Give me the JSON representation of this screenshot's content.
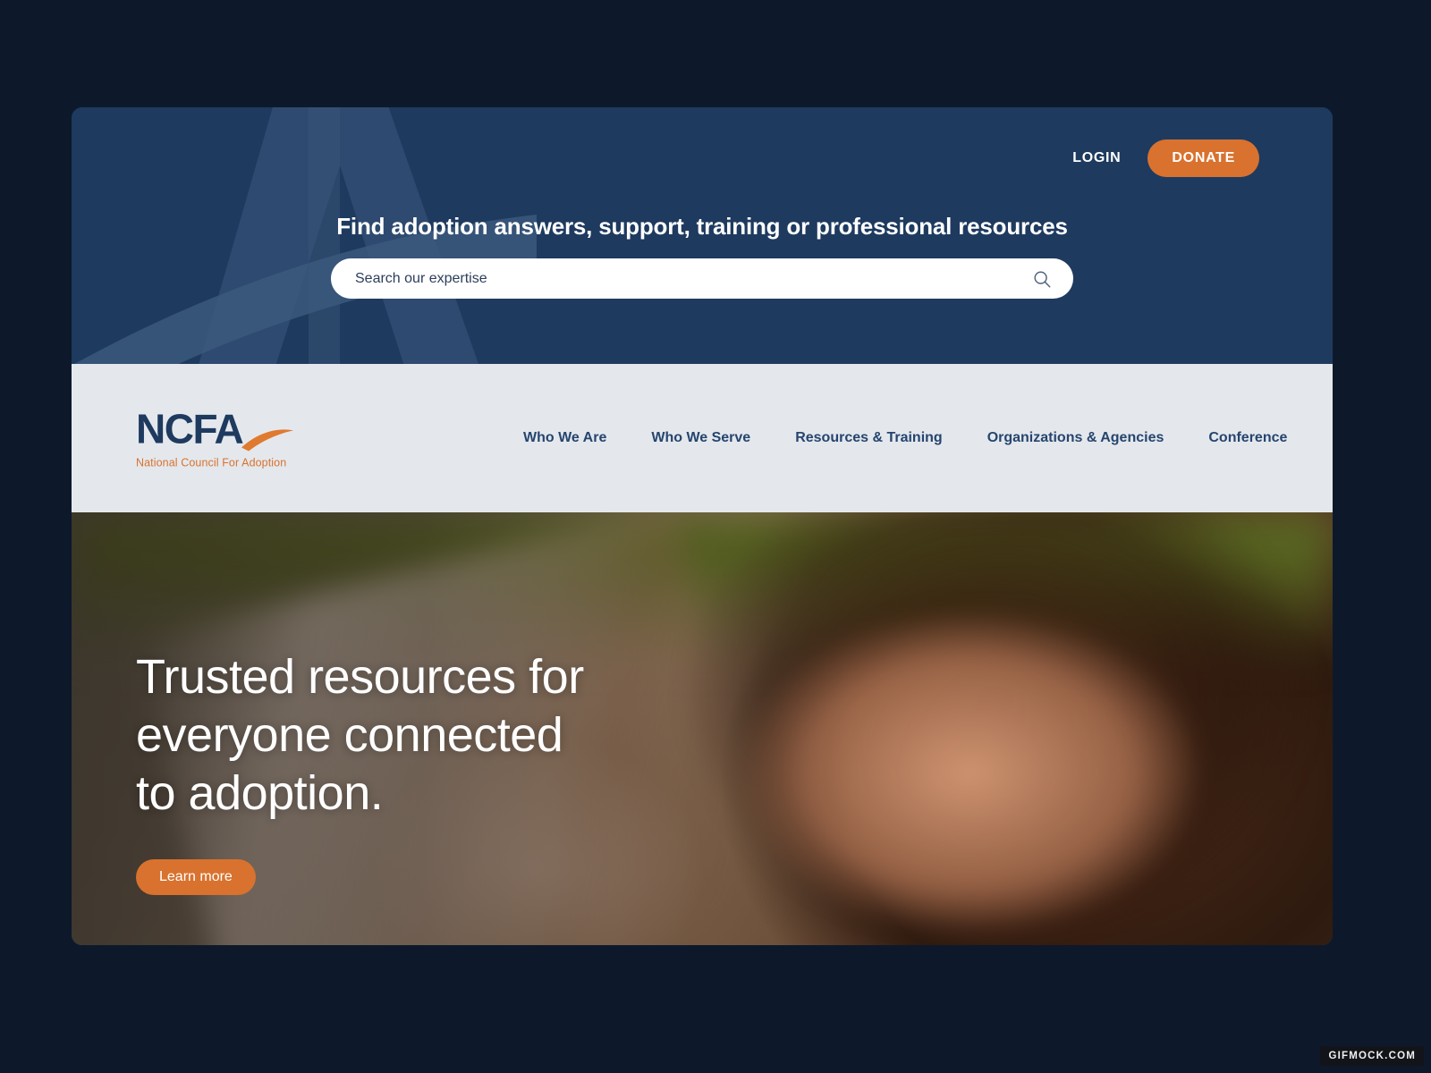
{
  "utility": {
    "login_label": "LOGIN",
    "donate_label": "DONATE"
  },
  "search": {
    "heading": "Find adoption answers, support, training or professional resources",
    "placeholder": "Search our expertise",
    "value": "",
    "icon": "search-icon"
  },
  "brand": {
    "mark_text": "NCFA",
    "tagline": "National Council For Adoption"
  },
  "nav": {
    "items": [
      {
        "label": "Who We Are"
      },
      {
        "label": "Who We Serve"
      },
      {
        "label": "Resources & Training"
      },
      {
        "label": "Organizations & Agencies"
      },
      {
        "label": "Conference"
      }
    ]
  },
  "hero": {
    "title_line1": "Trusted resources for",
    "title_line2": "everyone connected",
    "title_line3": "to adoption.",
    "cta_label": "Learn more"
  },
  "watermark": {
    "label": "GIFMOCK.COM"
  },
  "colors": {
    "page_background": "#0d192b",
    "band_navy": "#1e3a5f",
    "navbar_gray": "#e4e8ed",
    "accent_orange": "#d9722e",
    "nav_text": "#26456e",
    "logo_navy": "#1e3a5f"
  }
}
